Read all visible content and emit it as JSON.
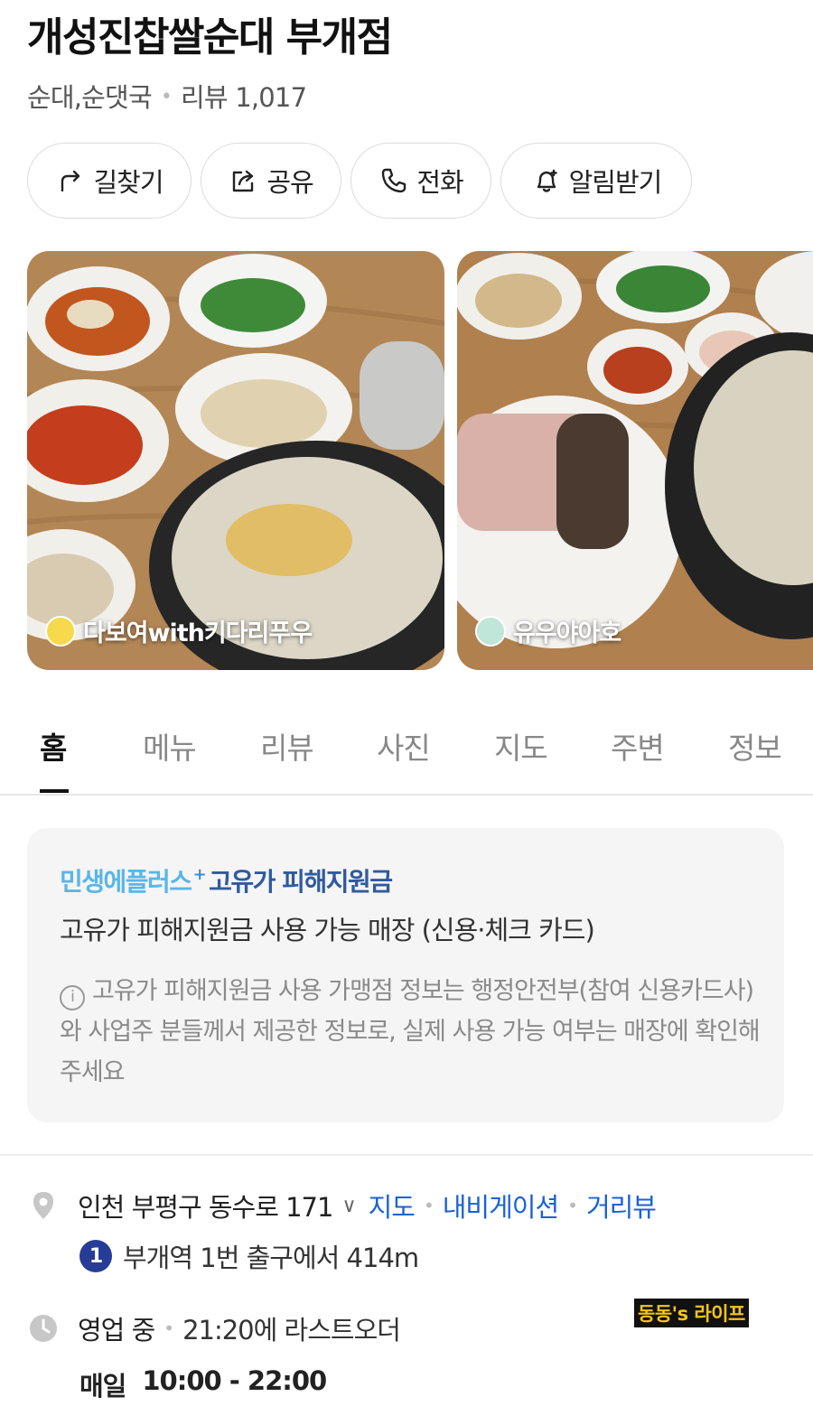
{
  "place": {
    "name": "개성진찹쌀순대 부개점",
    "category": "순대,순댓국",
    "review_label": "리뷰 1,017"
  },
  "actions": [
    {
      "label": "길찾기",
      "icon": "directions-icon"
    },
    {
      "label": "공유",
      "icon": "share-icon"
    },
    {
      "label": "전화",
      "icon": "phone-icon"
    },
    {
      "label": "알림받기",
      "icon": "bell-icon"
    }
  ],
  "photos": [
    {
      "credit": "다보여with키다리푸우",
      "avatar_color": "#f7d94c"
    },
    {
      "credit": "유우야아호",
      "avatar_color": "#bfe6d8"
    }
  ],
  "tabs": [
    "홈",
    "메뉴",
    "리뷰",
    "사진",
    "지도",
    "주변",
    "정보"
  ],
  "active_tab": "홈",
  "notice": {
    "brand_part1": "민생에플러스",
    "brand_plus": "+",
    "brand_part2": "고유가 피해지원금",
    "main": "고유가 피해지원금 사용 가능 매장 (신용·체크 카드)",
    "info_icon": "i",
    "info": "고유가 피해지원금 사용 가맹점 정보는 행정안전부(참여 신용카드사)와 사업주 분들께서 제공한 정보로, 실제 사용 가능 여부는 매장에 확인해주세요"
  },
  "address": {
    "text": "인천 부평구 동수로 171",
    "links": [
      "지도",
      "내비게이션",
      "거리뷰"
    ]
  },
  "station": {
    "line": "1",
    "line_color": "#263c96",
    "text": "부개역 1번 출구에서 414m"
  },
  "hours": {
    "status": "영업 중",
    "last_order": "21:20에 라스트오더",
    "day": "매일",
    "time": "10:00 - 22:00"
  },
  "watermark": "동동's 라이프",
  "colors": {
    "link": "#1a62d6",
    "brand_light": "#59b6e8",
    "brand_dark": "#2f5a9e"
  }
}
